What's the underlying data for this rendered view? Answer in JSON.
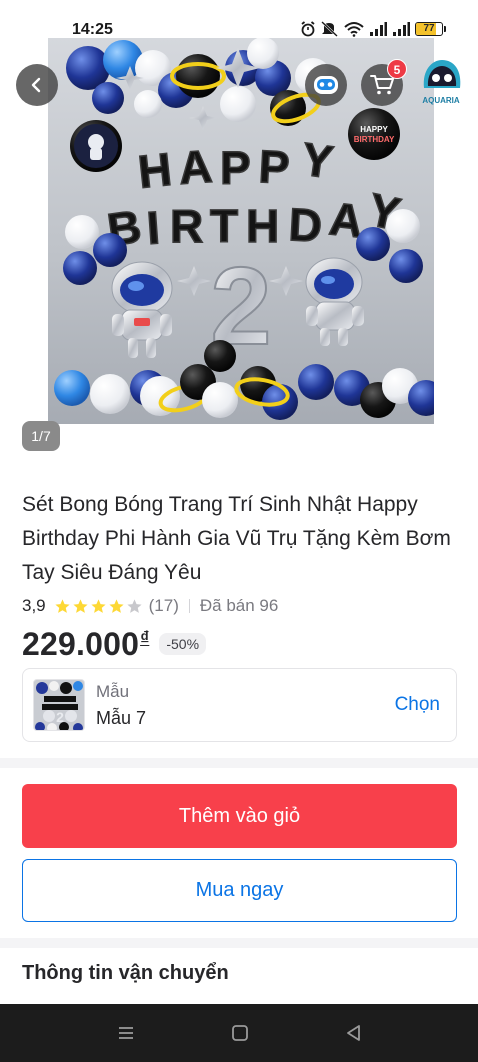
{
  "status_bar": {
    "time": "14:25",
    "battery_level": "77",
    "icons": [
      "alarm-icon",
      "mute-icon",
      "wifi-icon",
      "signal-icon",
      "signal-icon",
      "battery-icon"
    ]
  },
  "header": {
    "cart_count": "5",
    "brand_name": "AQUARIA"
  },
  "gallery": {
    "counter": "1/7"
  },
  "product": {
    "title": "Sét Bong Bóng Trang Trí Sinh Nhật Happy Birthday Phi Hành Gia Vũ Trụ Tặng Kèm Bơm Tay Siêu Đáng Yêu",
    "rating": "3,9",
    "stars": 3.9,
    "review_count": "(17)",
    "sold": "Đã bán 96",
    "price": "229.000",
    "currency": "₫",
    "discount": "-50%"
  },
  "variant": {
    "label": "Mẫu",
    "value": "Mẫu 7",
    "action": "Chọn"
  },
  "actions": {
    "add_to_cart": "Thêm vào giỏ",
    "buy_now": "Mua ngay"
  },
  "sections": {
    "shipping_title": "Thông tin vận chuyển"
  },
  "photo": {
    "banner_text": "HAPPY BIRTHDAY",
    "badge_text": "HAPPY BIRTHDAY",
    "number": "2"
  },
  "colors": {
    "accent_red": "#f8404b",
    "accent_blue": "#0b74e5",
    "badge_red": "#ee3a45",
    "star_yellow": "#fdd835"
  }
}
